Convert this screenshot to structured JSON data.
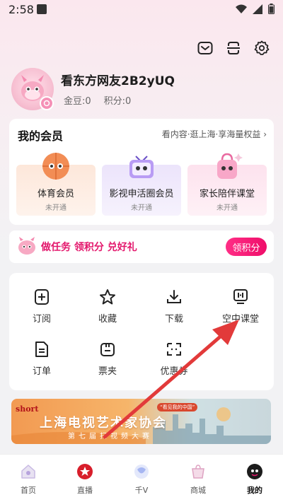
{
  "status_bar": {
    "time": "2:58"
  },
  "profile": {
    "username": "看东方网友2B2yUQ",
    "coins": "金豆:0",
    "points": "积分:0"
  },
  "member": {
    "title": "我的会员",
    "link": "看内容·逛上海·享海量权益",
    "tiles": [
      {
        "name": "体育会员",
        "status": "未开通"
      },
      {
        "name": "影视申活圈会员",
        "status": "未开通"
      },
      {
        "name": "家长陪伴课堂",
        "status": "未开通"
      }
    ]
  },
  "task": {
    "text": "做任务 领积分 兑好礼",
    "button": "领积分"
  },
  "services": [
    {
      "label": "订阅",
      "icon": "subscribe-icon"
    },
    {
      "label": "收藏",
      "icon": "star-icon"
    },
    {
      "label": "下载",
      "icon": "download-icon"
    },
    {
      "label": "空中课堂",
      "icon": "air-classroom-icon"
    },
    {
      "label": "订单",
      "icon": "order-icon"
    },
    {
      "label": "票夹",
      "icon": "wallet-icon"
    },
    {
      "label": "优惠券",
      "icon": "coupon-icon"
    }
  ],
  "ad": {
    "logo": "short",
    "main": "上海电视艺术家协会",
    "sub": "第七届扫视频大赛",
    "tag": "“看见我的中国”"
  },
  "nav": [
    {
      "label": "首页",
      "icon": "home-icon"
    },
    {
      "label": "直播",
      "icon": "live-icon"
    },
    {
      "label": "千V",
      "icon": "qianv-icon"
    },
    {
      "label": "商城",
      "icon": "mall-icon"
    },
    {
      "label": "我的",
      "icon": "mine-icon"
    }
  ],
  "colors": {
    "accent": "#e3176c",
    "background": "#f2f2f4"
  }
}
